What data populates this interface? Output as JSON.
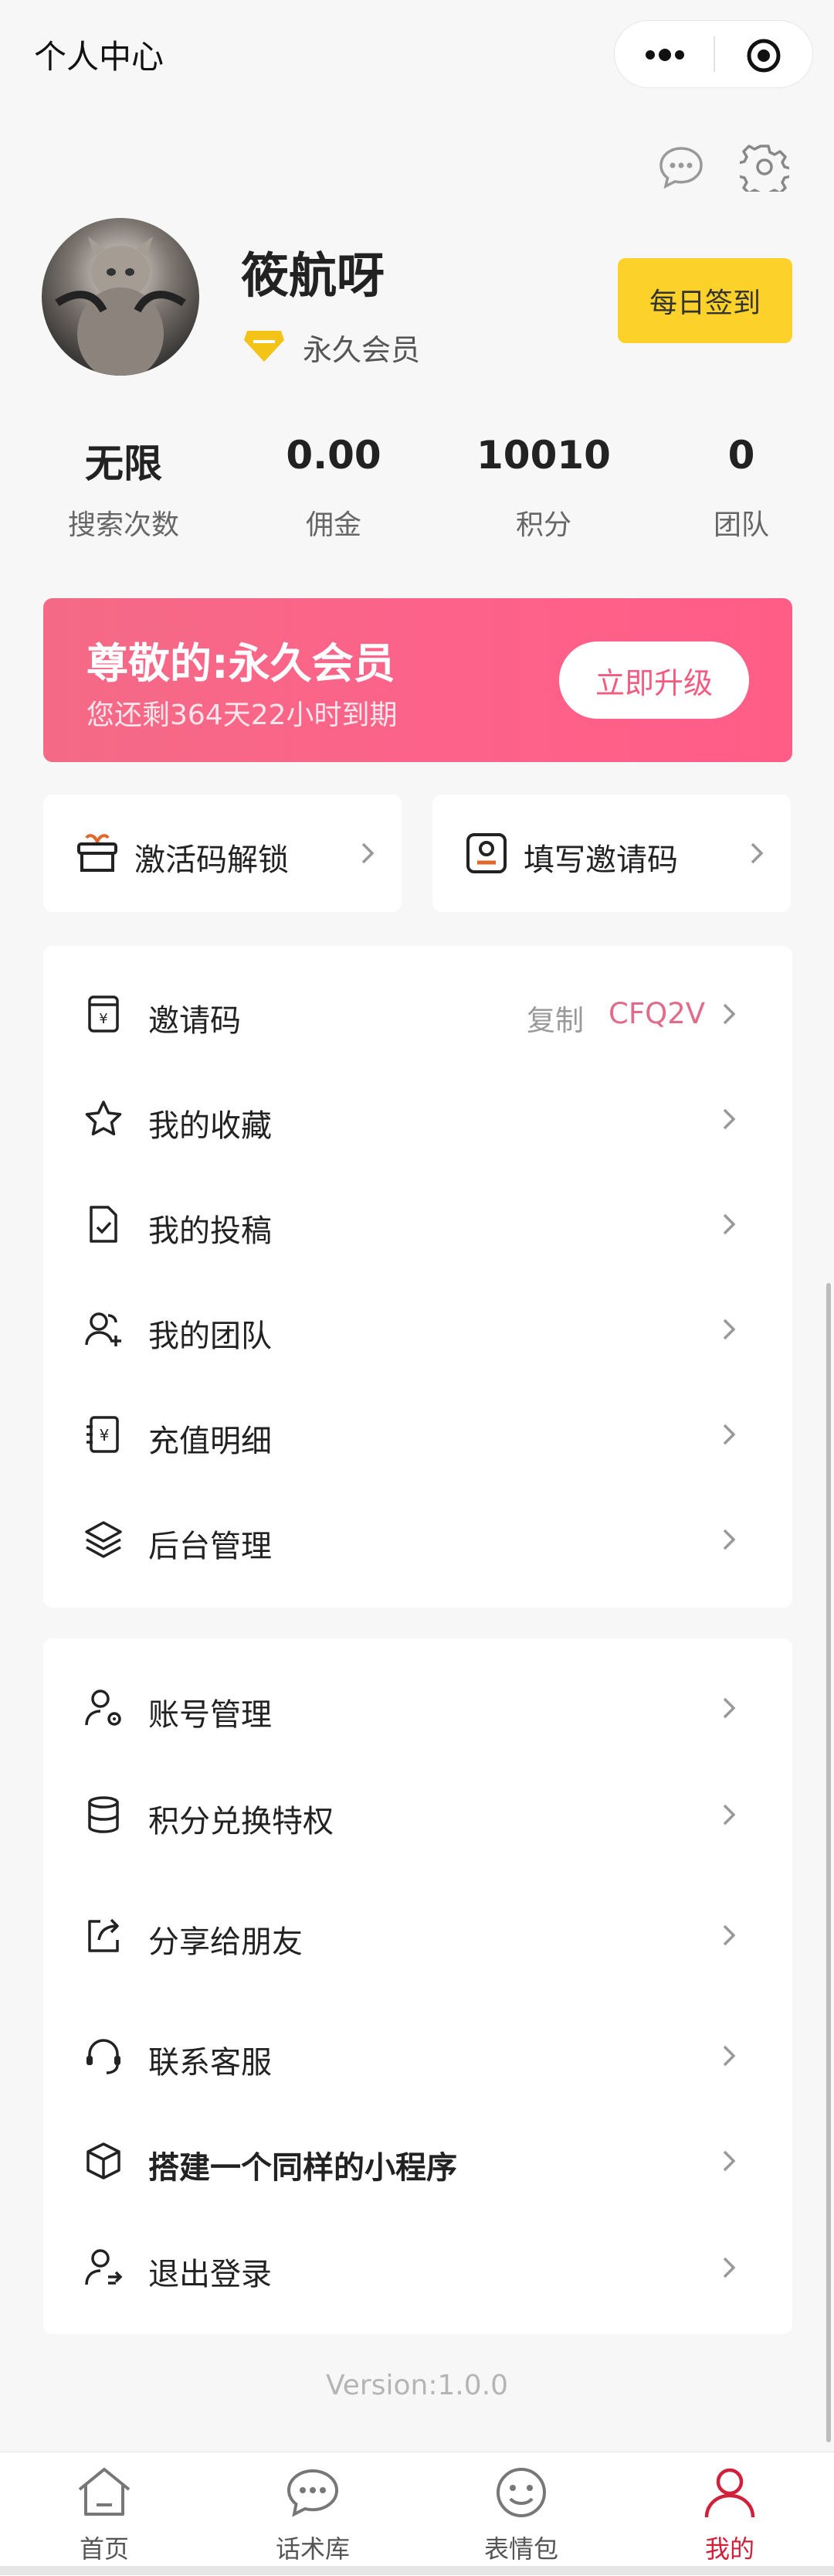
{
  "nav": {
    "title": "个人中心"
  },
  "profile": {
    "username": "筱航呀",
    "membership": "永久会员",
    "checkin_label": "每日签到"
  },
  "stats": [
    {
      "value": "无限",
      "label": "搜索次数"
    },
    {
      "value": "0.00",
      "label": "佣金"
    },
    {
      "value": "10010",
      "label": "积分"
    },
    {
      "value": "0",
      "label": "团队"
    }
  ],
  "vip_banner": {
    "title": "尊敬的:永久会员",
    "subtitle": "您还剩364天22小时到期",
    "upgrade_label": "立即升级"
  },
  "quick_actions": [
    {
      "label": "激活码解锁",
      "icon": "gift-box-icon"
    },
    {
      "label": "填写邀请码",
      "icon": "user-card-icon"
    }
  ],
  "menu_group1": [
    {
      "label": "邀请码",
      "icon": "invite-code-icon",
      "copy_label": "复制",
      "code": "CFQ2V"
    },
    {
      "label": "我的收藏",
      "icon": "star-icon"
    },
    {
      "label": "我的投稿",
      "icon": "document-check-icon"
    },
    {
      "label": "我的团队",
      "icon": "team-icon"
    },
    {
      "label": "充值明细",
      "icon": "recharge-icon"
    },
    {
      "label": "后台管理",
      "icon": "layers-icon"
    }
  ],
  "menu_group2": [
    {
      "label": "账号管理",
      "icon": "user-settings-icon"
    },
    {
      "label": "积分兑换特权",
      "icon": "database-icon"
    },
    {
      "label": "分享给朋友",
      "icon": "share-icon"
    },
    {
      "label": "联系客服",
      "icon": "headset-icon"
    },
    {
      "label": "搭建一个同样的小程序",
      "icon": "cube-icon"
    },
    {
      "label": "退出登录",
      "icon": "logout-user-icon"
    }
  ],
  "version": "Version:1.0.0",
  "tabbar": [
    {
      "label": "首页",
      "icon": "home-icon",
      "active": false
    },
    {
      "label": "话术库",
      "icon": "chat-icon",
      "active": false
    },
    {
      "label": "表情包",
      "icon": "smile-icon",
      "active": false
    },
    {
      "label": "我的",
      "icon": "profile-icon",
      "active": true
    }
  ],
  "colors": {
    "accent": "#fcd22a",
    "vip_pink": "#fd628a",
    "active_tab": "#d0203a"
  }
}
